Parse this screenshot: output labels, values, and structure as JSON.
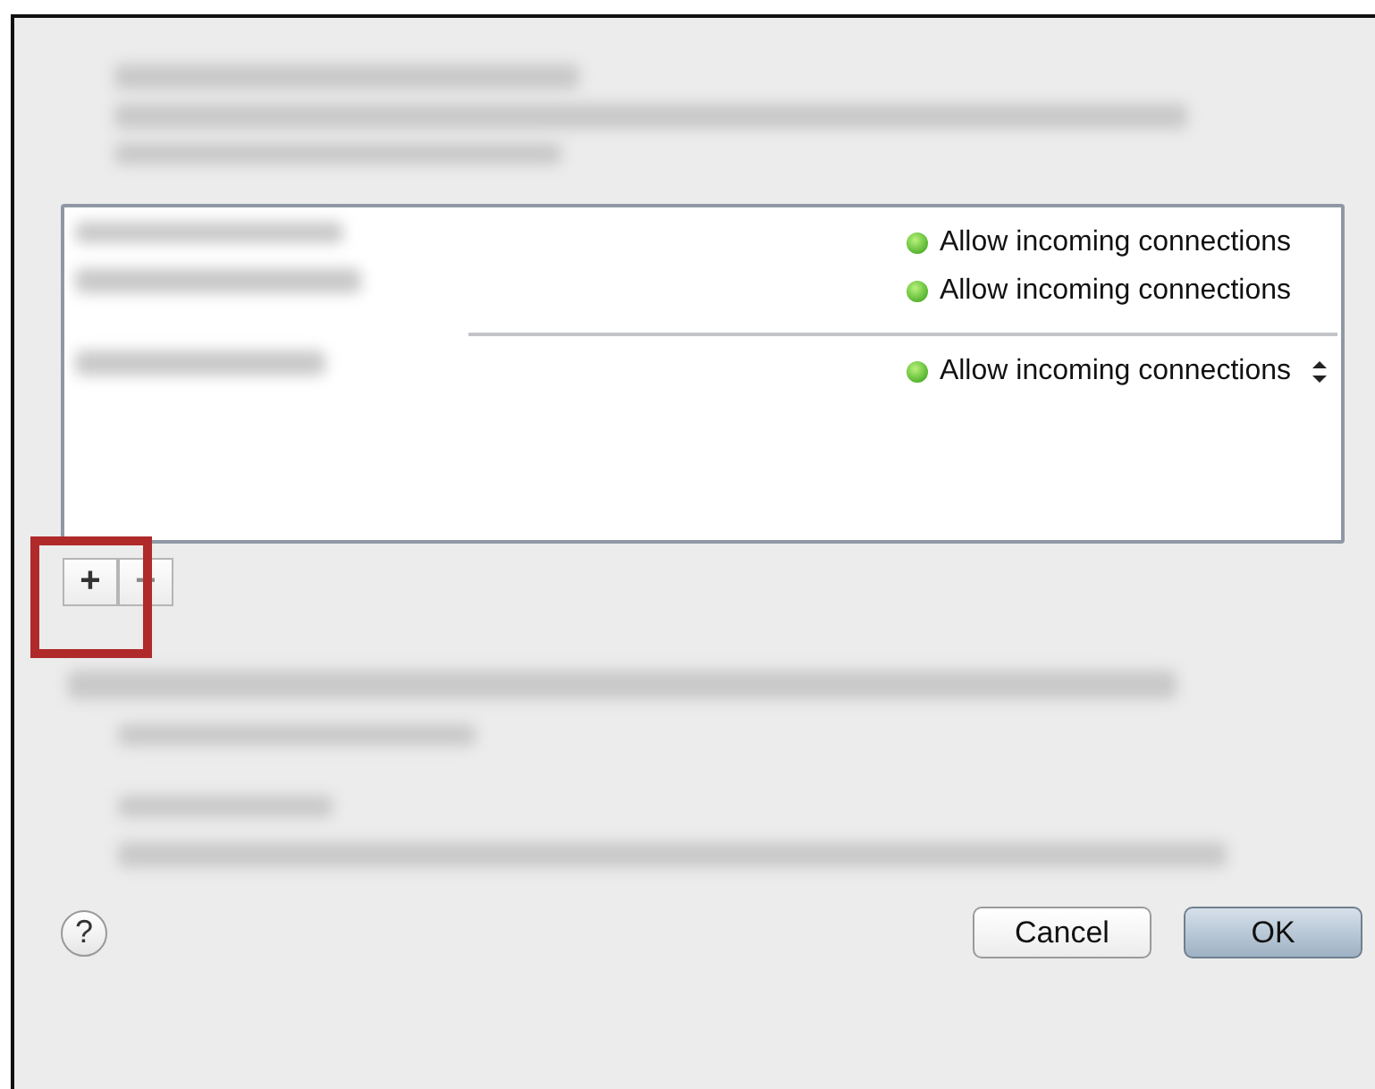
{
  "rules": [
    {
      "label": "Allow incoming connections",
      "kind": "plain"
    },
    {
      "label": "Allow incoming connections",
      "kind": "plain"
    },
    {
      "label": "Allow incoming connections",
      "kind": "popup"
    }
  ],
  "list_buttons": [
    {
      "label": "+",
      "disabled": false,
      "highlighted": true
    },
    {
      "label": "−",
      "disabled": true,
      "highlighted": false
    }
  ],
  "help": "?",
  "buttons": [
    {
      "label": "Cancel",
      "default": false
    },
    {
      "label": "OK",
      "default": true
    }
  ]
}
